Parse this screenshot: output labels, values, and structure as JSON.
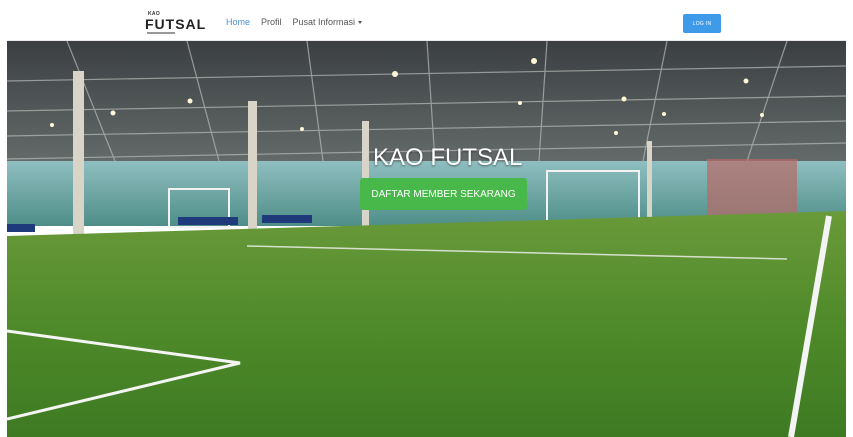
{
  "navbar": {
    "brand_small": "KAO",
    "brand_main": "FUTSAL",
    "links": [
      {
        "label": "Home"
      },
      {
        "label": "Profil"
      },
      {
        "label": "Pusat Informasi"
      }
    ],
    "login_label": "LOG IN"
  },
  "hero": {
    "title": "KAO FUTSAL",
    "button_label": "DAFTAR MEMBER SEKARANG"
  },
  "colors": {
    "accent": "#3d9be9",
    "active_link": "#4a90d9",
    "cta": "#49b84b",
    "turf": "#4f8a2a"
  }
}
